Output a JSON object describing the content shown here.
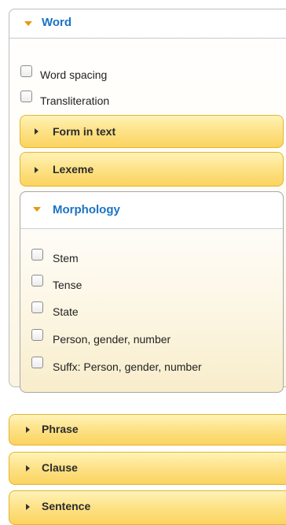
{
  "word": {
    "title": "Word",
    "checkboxes": [
      {
        "label": "Word spacing",
        "checked": false
      },
      {
        "label": "Transliteration",
        "checked": false
      }
    ],
    "sub_sections": [
      {
        "label": "Form in text"
      },
      {
        "label": "Lexeme"
      }
    ],
    "morphology": {
      "title": "Morphology",
      "checkboxes": [
        {
          "label": "Stem",
          "checked": false
        },
        {
          "label": "Tense",
          "checked": false
        },
        {
          "label": "State",
          "checked": false
        },
        {
          "label": "Person, gender, number",
          "checked": false
        },
        {
          "label": "Suffx: Person, gender, number",
          "checked": false
        }
      ]
    }
  },
  "sections": [
    {
      "label": "Phrase"
    },
    {
      "label": "Clause"
    },
    {
      "label": "Sentence"
    }
  ],
  "colors": {
    "accent_blue": "#1a73c4",
    "caret_orange": "#e59a10",
    "bar_yellow": "#fde38a",
    "bar_border": "#e5b430"
  }
}
